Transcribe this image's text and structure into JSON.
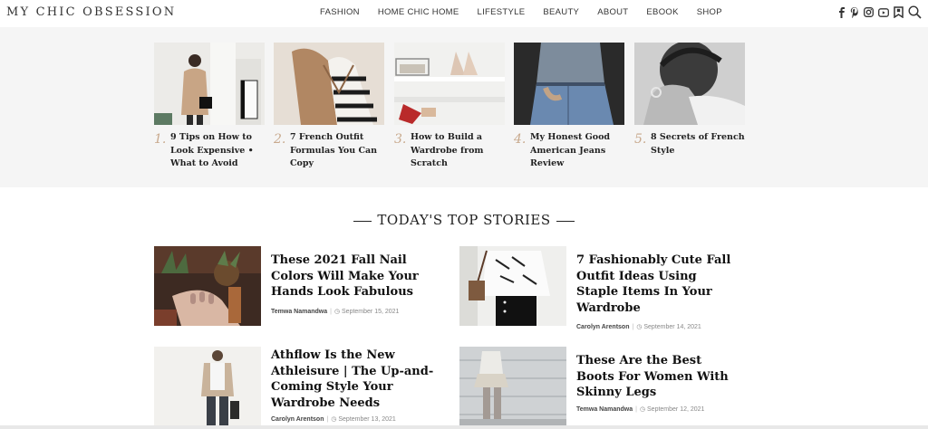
{
  "header": {
    "logo": "MY CHIC OBSESSION",
    "nav": [
      "FASHION",
      "HOME CHIC HOME",
      "LIFESTYLE",
      "BEAUTY",
      "ABOUT",
      "EBOOK",
      "SHOP"
    ],
    "icons": [
      "facebook-icon",
      "pinterest-icon",
      "instagram-icon",
      "youtube-icon",
      "bookmark-icon",
      "search-icon"
    ]
  },
  "featured": [
    {
      "num": "1.",
      "title": "9 Tips on How to Look Expensive • What to Avoid"
    },
    {
      "num": "2.",
      "title": "7 French Outfit Formulas You Can Copy"
    },
    {
      "num": "3.",
      "title": "How to Build a Wardrobe from Scratch"
    },
    {
      "num": "4.",
      "title": "My Honest Good American Jeans Review"
    },
    {
      "num": "5.",
      "title": "8 Secrets of French Style"
    }
  ],
  "section_title": "TODAY'S TOP STORIES",
  "stories": [
    {
      "title": "These 2021 Fall Nail Colors Will Make Your Hands Look Fabulous",
      "author": "Temwa Namandwa",
      "date": "September 15, 2021"
    },
    {
      "title": "7 Fashionably Cute Fall Outfit Ideas Using Staple Items In Your Wardrobe",
      "author": "Carolyn Arentson",
      "date": "September 14, 2021"
    },
    {
      "title": "Athflow Is the New Athleisure | The Up-and-Coming Style Your Wardrobe Needs",
      "author": "Carolyn Arentson",
      "date": "September 13, 2021"
    },
    {
      "title": "These Are the Best Boots For Women With Skinny Legs",
      "author": "Temwa Namandwa",
      "date": "September 12, 2021"
    }
  ],
  "colors": {
    "accent_number": "#c8a98d",
    "band_bg": "#f5f5f5"
  }
}
